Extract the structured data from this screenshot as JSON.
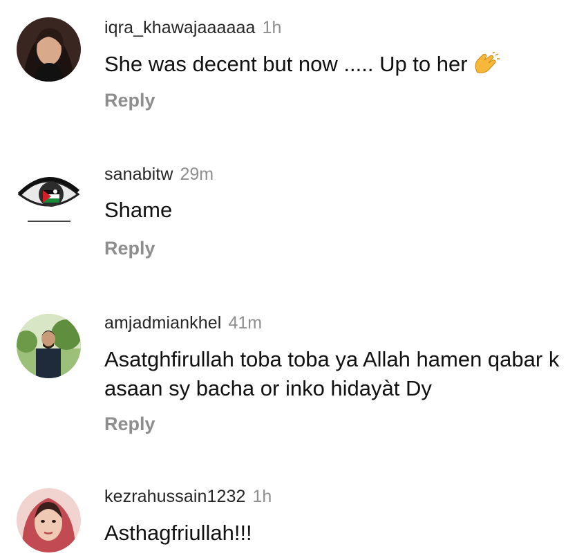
{
  "comments": [
    {
      "username": "iqra_khawajaaaaaa",
      "time": "1h",
      "text": "She was decent but now ..... Up to her",
      "emoji_icon": "clapping-hands-icon",
      "reply_label": "Reply"
    },
    {
      "username": "sanabitw",
      "time": "29m",
      "text": "Shame",
      "reply_label": "Reply"
    },
    {
      "username": "amjadmiankhel",
      "time": "41m",
      "text": "Asatghfirullah toba toba ya Allah hamen qabar k asaan sy bacha or inko hidayàt Dy",
      "reply_label": "Reply"
    },
    {
      "username": "kezrahussain1232",
      "time": "1h",
      "text": "Asthagfriullah!!!"
    }
  ],
  "colors": {
    "username": "#262626",
    "secondary": "#8e8e8e",
    "text": "#111111",
    "clap": "#f6b83a"
  }
}
